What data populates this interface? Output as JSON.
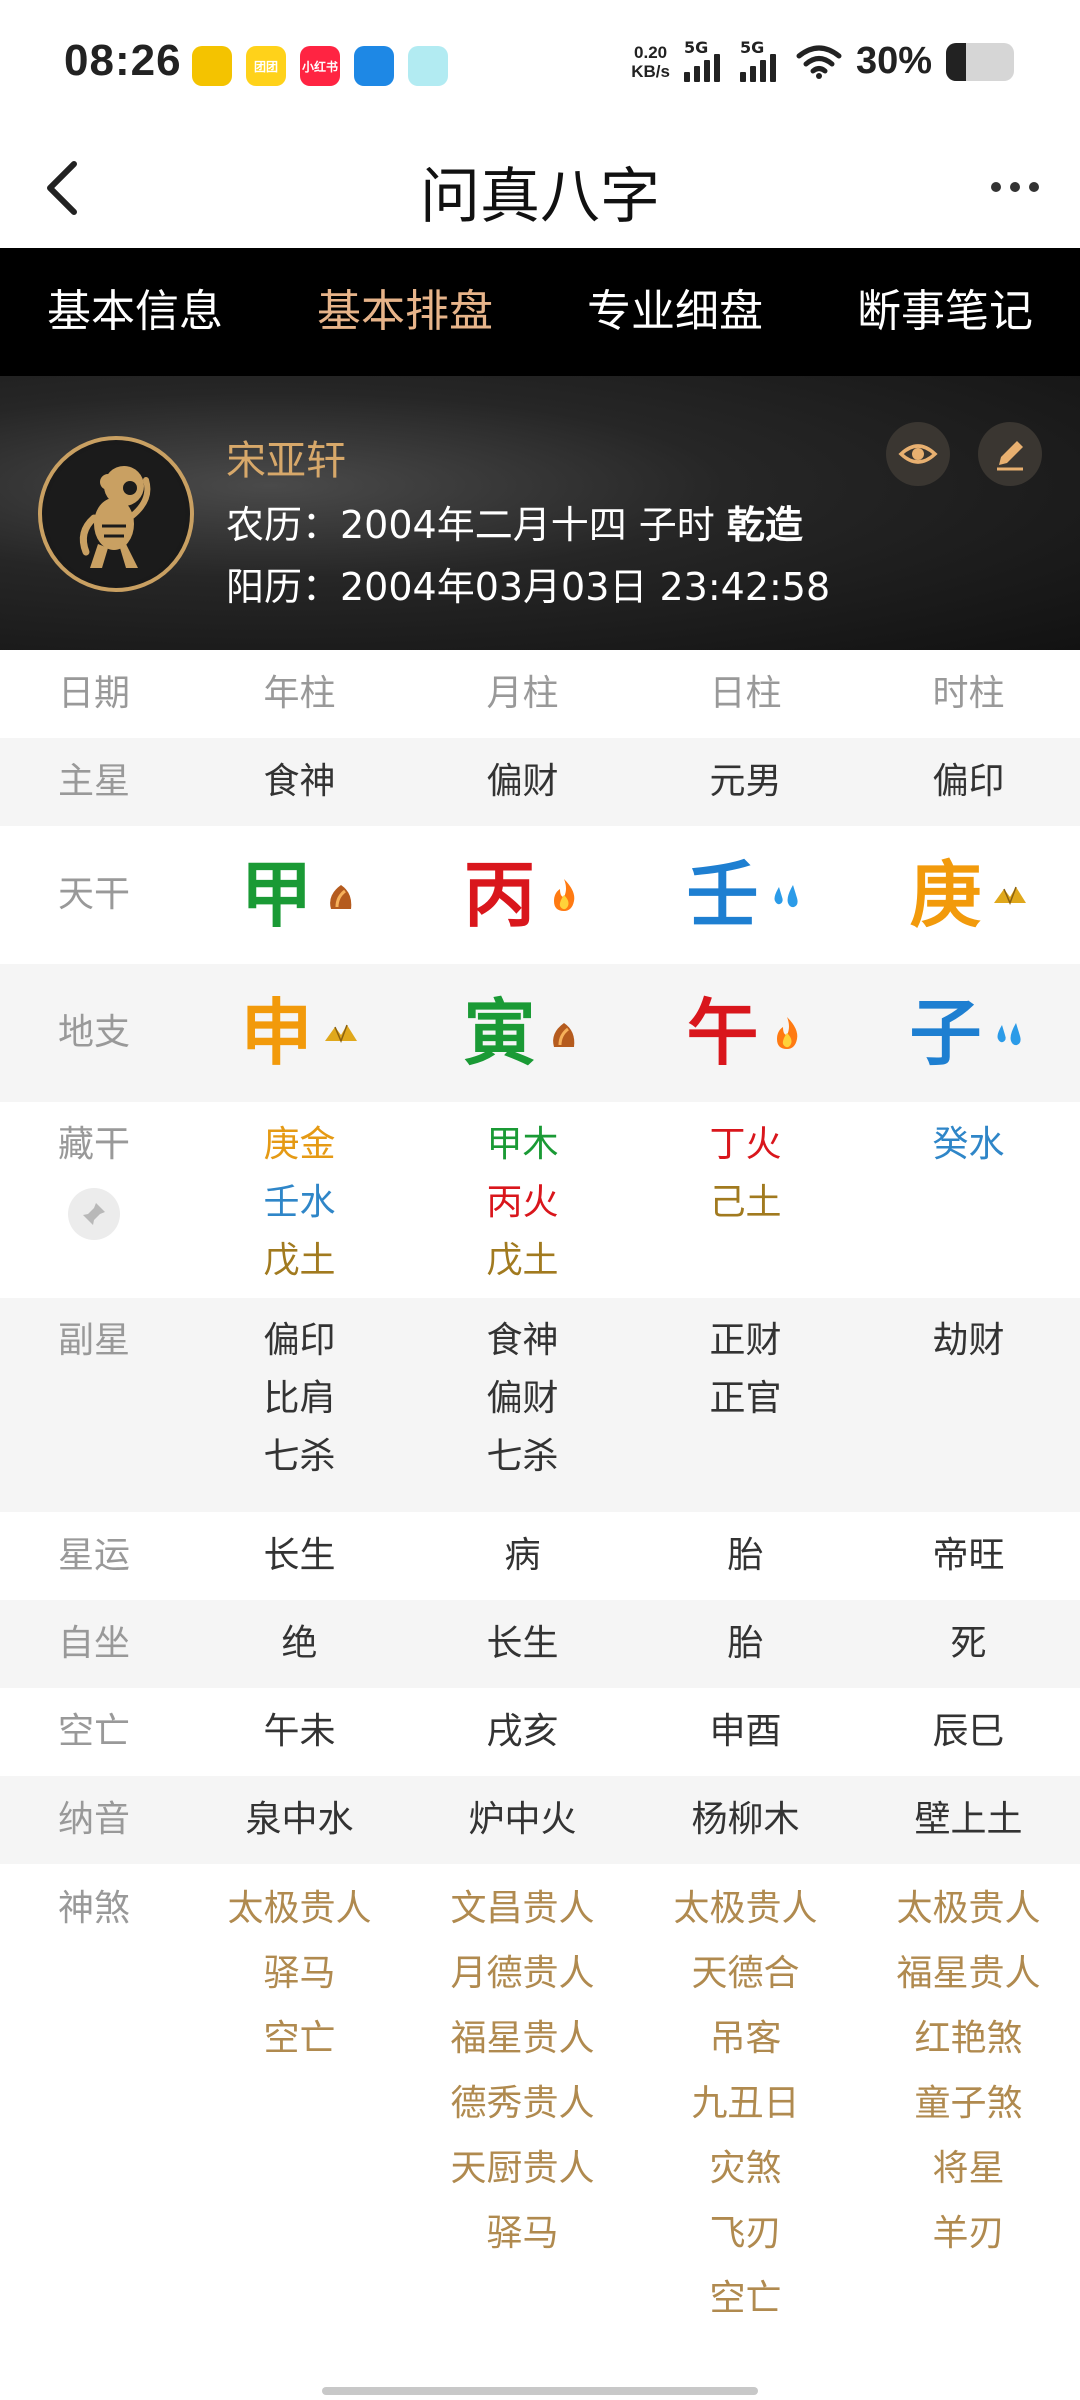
{
  "status_bar": {
    "time": "08:26",
    "apps": [
      {
        "name": "weibo-icon",
        "color": "#f4c300",
        "text": ""
      },
      {
        "name": "app-yellow-icon",
        "color": "#ffd21a",
        "text": "团团"
      },
      {
        "name": "xiaohongshu-icon",
        "color": "#ff2442",
        "text": "小红书"
      },
      {
        "name": "app-blue-icon",
        "color": "#1e88e5",
        "text": ""
      },
      {
        "name": "app-teal-icon",
        "color": "#b2ebf2",
        "text": ""
      }
    ],
    "net_speed_value": "0.20",
    "net_speed_unit": "KB/s",
    "sim1_label": "5G",
    "sim2_label": "5G",
    "battery_pct": "30%",
    "battery_level": 0.3
  },
  "nav": {
    "title": "问真八字"
  },
  "tabs": [
    {
      "label": "基本信息",
      "active": false
    },
    {
      "label": "基本排盘",
      "active": true
    },
    {
      "label": "专业细盘",
      "active": false
    },
    {
      "label": "断事笔记",
      "active": false
    }
  ],
  "profile": {
    "name": "宋亚轩",
    "lunar_prefix": "农历：2004年二月十四 子时 ",
    "lunar_suffix": "乾造",
    "solar": "阳历：2004年03月03日 23:42:58"
  },
  "table": {
    "header": {
      "label": "日期",
      "cols": [
        "年柱",
        "月柱",
        "日柱",
        "时柱"
      ]
    },
    "main_star": {
      "label": "主星",
      "cols": [
        "食神",
        "偏财",
        "元男",
        "偏印"
      ]
    },
    "tiangan": {
      "label": "天干",
      "cols": [
        {
          "char": "甲",
          "color": "#1a9a35",
          "element": "wood"
        },
        {
          "char": "丙",
          "color": "#d9161c",
          "element": "fire"
        },
        {
          "char": "壬",
          "color": "#1e7fd1",
          "element": "water"
        },
        {
          "char": "庚",
          "color": "#f29a0b",
          "element": "metal"
        }
      ]
    },
    "dizhi": {
      "label": "地支",
      "cols": [
        {
          "char": "申",
          "color": "#f29a0b",
          "element": "metal"
        },
        {
          "char": "寅",
          "color": "#1a9a35",
          "element": "wood"
        },
        {
          "char": "午",
          "color": "#d9161c",
          "element": "fire"
        },
        {
          "char": "子",
          "color": "#1e7fd1",
          "element": "water"
        }
      ]
    },
    "canggan": {
      "label": "藏干",
      "cols": [
        [
          {
            "t": "庚金",
            "c": "#e59a14"
          },
          {
            "t": "壬水",
            "c": "#2f86c8"
          },
          {
            "t": "戊土",
            "c": "#a17a1f"
          }
        ],
        [
          {
            "t": "甲木",
            "c": "#1a9a35"
          },
          {
            "t": "丙火",
            "c": "#d9161c"
          },
          {
            "t": "戊土",
            "c": "#a17a1f"
          }
        ],
        [
          {
            "t": "丁火",
            "c": "#d9161c"
          },
          {
            "t": "己土",
            "c": "#a17a1f"
          }
        ],
        [
          {
            "t": "癸水",
            "c": "#2f86c8"
          }
        ]
      ]
    },
    "fuxing": {
      "label": "副星",
      "cols": [
        [
          "偏印",
          "比肩",
          "七杀"
        ],
        [
          "食神",
          "偏财",
          "七杀"
        ],
        [
          "正财",
          "正官"
        ],
        [
          "劫财"
        ]
      ]
    },
    "xingyun": {
      "label": "星运",
      "cols": [
        "长生",
        "病",
        "胎",
        "帝旺"
      ]
    },
    "zizuo": {
      "label": "自坐",
      "cols": [
        "绝",
        "长生",
        "胎",
        "死"
      ]
    },
    "kongwang": {
      "label": "空亡",
      "cols": [
        "午未",
        "戌亥",
        "申酉",
        "辰巳"
      ]
    },
    "nayin": {
      "label": "纳音",
      "cols": [
        "泉中水",
        "炉中火",
        "杨柳木",
        "壁上土"
      ]
    },
    "shensha": {
      "label": "神煞",
      "color": "#b08a4f",
      "cols": [
        [
          "太极贵人",
          "驿马",
          "空亡"
        ],
        [
          "文昌贵人",
          "月德贵人",
          "福星贵人",
          "德秀贵人",
          "天厨贵人",
          "驿马"
        ],
        [
          "太极贵人",
          "天德合",
          "吊客",
          "九丑日",
          "灾煞",
          "飞刃",
          "空亡"
        ],
        [
          "太极贵人",
          "福星贵人",
          "红艳煞",
          "童子煞",
          "将星",
          "羊刃"
        ]
      ]
    }
  }
}
